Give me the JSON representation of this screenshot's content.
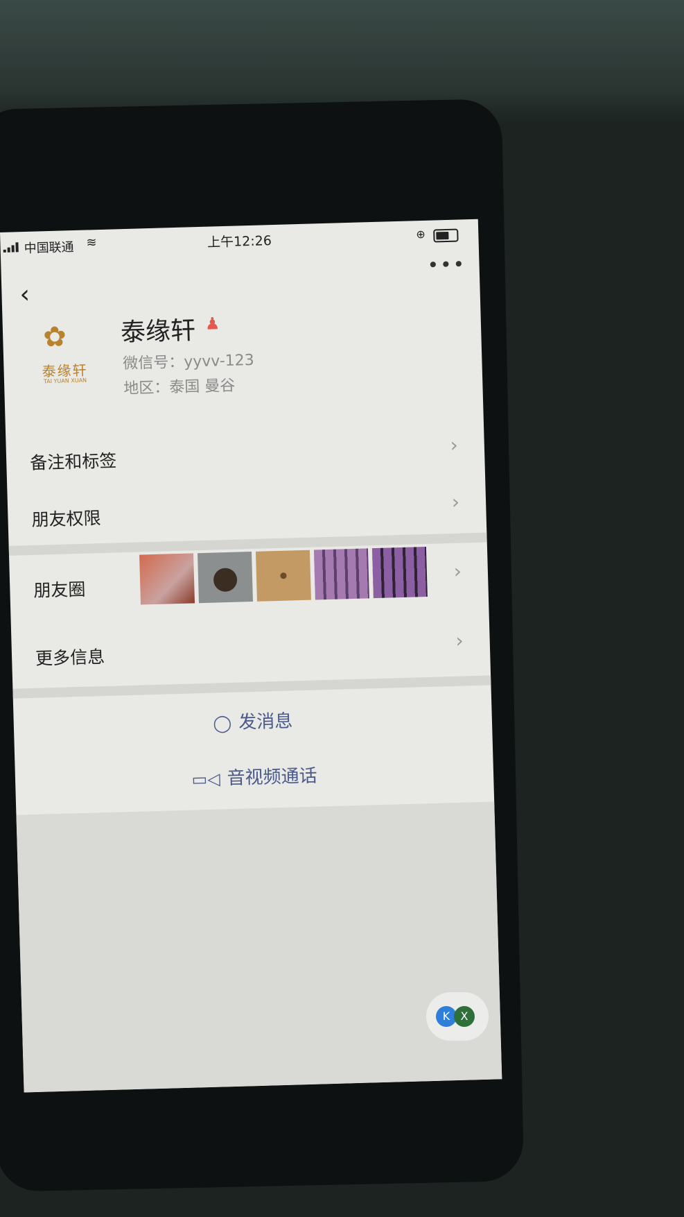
{
  "status_bar": {
    "carrier": "中国联通",
    "time": "上午12:26"
  },
  "icons": {
    "back": "chevron-left-icon",
    "more": "more-dots-icon",
    "person": "person-icon",
    "chevron": "chevron-right-icon",
    "message": "chat-bubble-icon",
    "video": "video-camera-icon"
  },
  "profile": {
    "name": "泰缘轩",
    "wechat_id": "微信号：yyvv-123",
    "region": "地区：泰国 曼谷",
    "logo_text": "泰缘轩",
    "logo_subtext": "TAI YUAN XUAN"
  },
  "menu": {
    "remarks_tags": "备注和标签",
    "friend_permissions": "朋友权限",
    "moments": "朋友圈",
    "more_info": "更多信息"
  },
  "actions": {
    "send_message": "发消息",
    "av_call": "音视频通话"
  },
  "floating": {
    "k_label": "K",
    "x_label": "X"
  },
  "colors": {
    "accent_link": "#4a5a8a",
    "person_badge": "#e6574d",
    "logo_gold": "#b8822f"
  }
}
